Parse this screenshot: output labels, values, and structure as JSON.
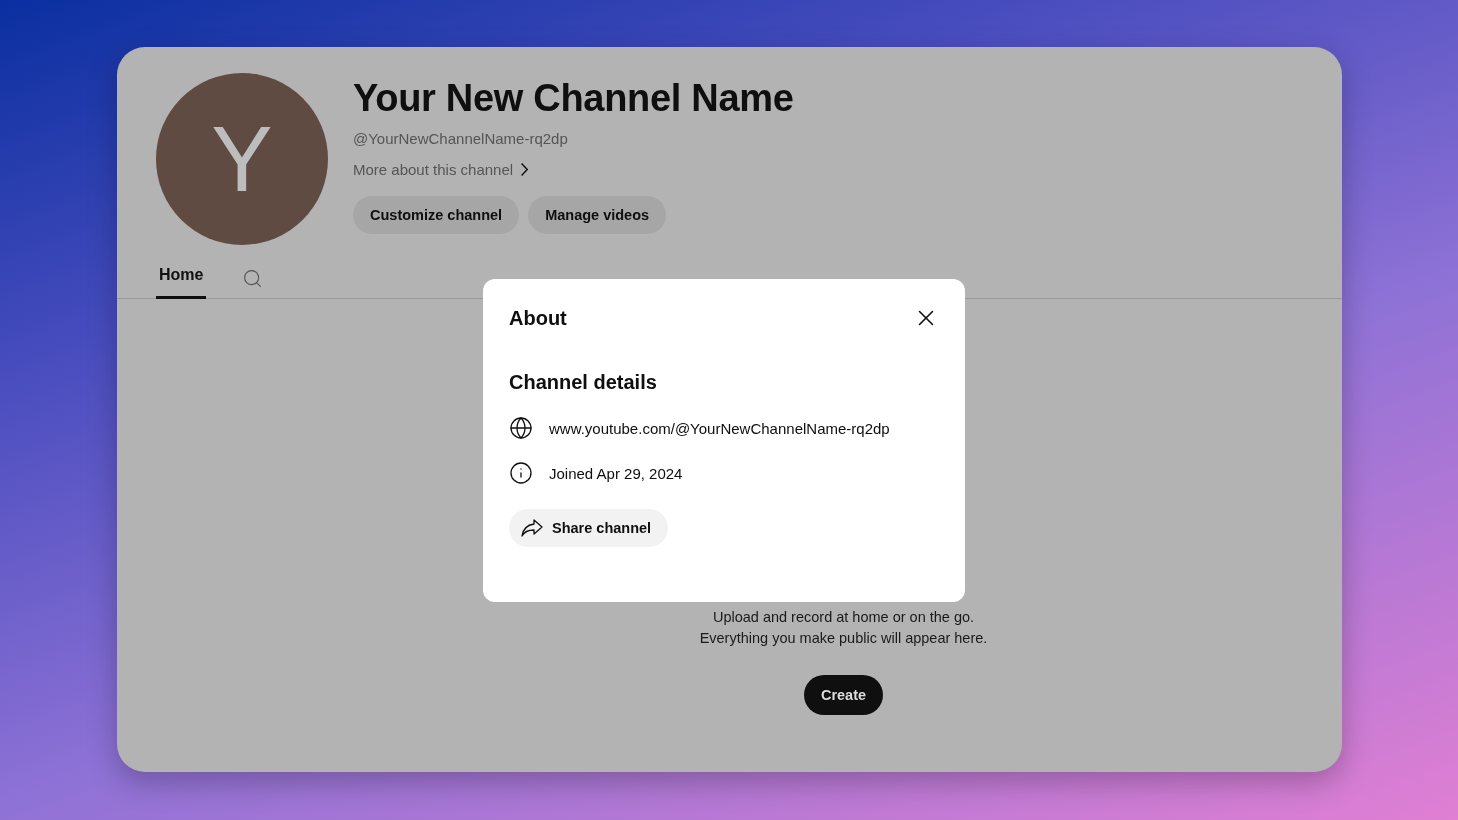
{
  "channel": {
    "avatar_letter": "Y",
    "name": "Your New Channel Name",
    "handle": "@YourNewChannelName-rq2dp",
    "more_link": "More about this channel",
    "buttons": [
      "Customize channel",
      "Manage videos"
    ]
  },
  "tabs": [
    {
      "label": "Home",
      "selected": true
    }
  ],
  "empty_state": {
    "lines": [
      "Upload and record at home or on the go.",
      "Everything you make public will appear here."
    ],
    "button": "Create"
  },
  "dialog": {
    "title": "About",
    "section_title": "Channel details",
    "details": [
      {
        "kind": "link",
        "text": "www.youtube.com/@YourNewChannelName-rq2dp"
      },
      {
        "kind": "joined",
        "text": "Joined Apr 29, 2024"
      }
    ],
    "share_button": "Share channel"
  }
}
